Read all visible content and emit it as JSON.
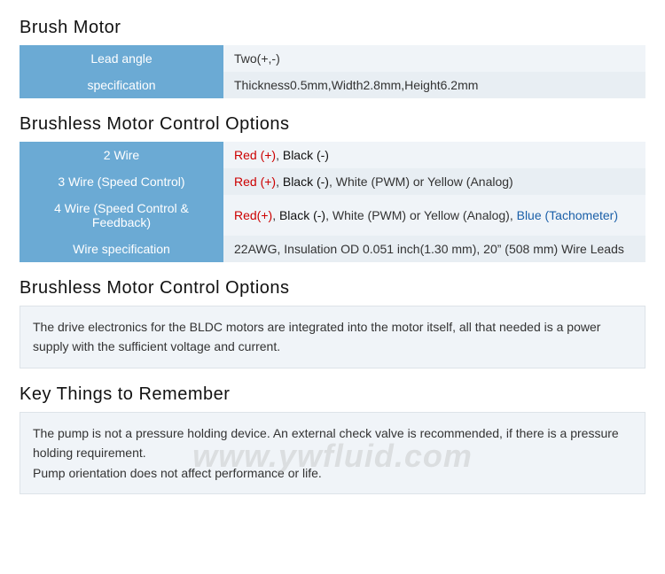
{
  "sections": {
    "brush_motor": {
      "title": "Brush Motor",
      "rows": [
        {
          "label": "Lead angle",
          "value": "Two(+,-)",
          "value_type": "plain"
        },
        {
          "label": "specification",
          "value": "Thickness0.5mm,Width2.8mm,Height6.2mm",
          "value_type": "plain"
        }
      ]
    },
    "brushless_control": {
      "title": "Brushless Motor Control Options",
      "rows": [
        {
          "label": "2 Wire",
          "value_parts": [
            {
              "text": "Red (+)",
              "color": "red"
            },
            {
              "text": ", ",
              "color": "plain"
            },
            {
              "text": "Black (-)",
              "color": "black"
            }
          ]
        },
        {
          "label": "3 Wire (Speed Control)",
          "value_parts": [
            {
              "text": "Red (+)",
              "color": "red"
            },
            {
              "text": ", ",
              "color": "plain"
            },
            {
              "text": "Black (-)",
              "color": "black"
            },
            {
              "text": ", White (PWM) or Yellow (Analog)",
              "color": "plain"
            }
          ]
        },
        {
          "label": "4 Wire (Speed Control & Feedback)",
          "value_parts": [
            {
              "text": "Red(+)",
              "color": "red"
            },
            {
              "text": ", ",
              "color": "plain"
            },
            {
              "text": "Black (-)",
              "color": "black"
            },
            {
              "text": ", White (PWM) or Yellow (Analog), ",
              "color": "plain"
            },
            {
              "text": "Blue (Tachometer)",
              "color": "blue"
            }
          ]
        },
        {
          "label": "Wire specification",
          "value_parts": [
            {
              "text": "22AWG, Insulation OD 0.051 inch(1.30 mm), 20” (508 mm) Wire Leads",
              "color": "plain"
            }
          ]
        }
      ]
    },
    "brushless_description": {
      "title": "Brushless Motor Control Options",
      "description": "The drive electronics for the BLDC motors are integrated into the motor itself, all that needed is a power supply with the sufficient voltage and current."
    },
    "key_things": {
      "title": "Key Things to Remember",
      "description_lines": [
        "The pump is not a pressure holding device. An external check valve is recommended, if there is a pressure holding requirement.",
        "Pump orientation does not affect performance or life."
      ]
    }
  },
  "watermark": "www.ywfluid.com"
}
